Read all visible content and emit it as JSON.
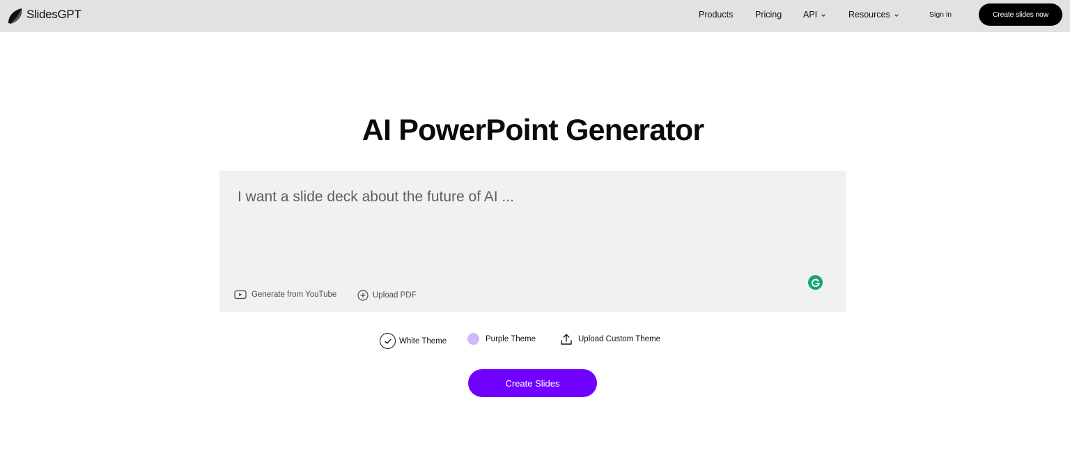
{
  "header": {
    "brand": "SlidesGPT",
    "nav": [
      {
        "label": "Products"
      },
      {
        "label": "Pricing"
      },
      {
        "label": "API"
      },
      {
        "label": "Resources"
      }
    ],
    "sign_in": "Sign in",
    "cta": "Create slides now"
  },
  "main": {
    "title": "AI PowerPoint Generator",
    "prompt": {
      "value": "",
      "placeholder": "I want a slide deck about the future of AI ..."
    },
    "tools": {
      "youtube": "Generate from YouTube",
      "pdf": "Upload PDF"
    },
    "themes": {
      "white": "White Theme",
      "purple": "Purple Theme",
      "custom": "Upload Custom Theme",
      "selected": "White Theme"
    },
    "create_button": "Create Slides"
  },
  "colors": {
    "header_bg": "#e2e2e2",
    "cta_bg": "#000000",
    "accent": "#7000ff",
    "purple_theme_swatch": "#d3b8fb",
    "prompt_bg": "#f1f1f1",
    "grammarly": "#15a577"
  },
  "icons": {
    "logo": "slidesgpt-logo",
    "youtube": "youtube-play-icon",
    "pdf": "plus-circle-icon",
    "selected_theme": "check-circle-icon",
    "custom_theme": "upload-icon",
    "grammarly": "grammarly-icon",
    "dropdown": "chevron-down-icon"
  }
}
